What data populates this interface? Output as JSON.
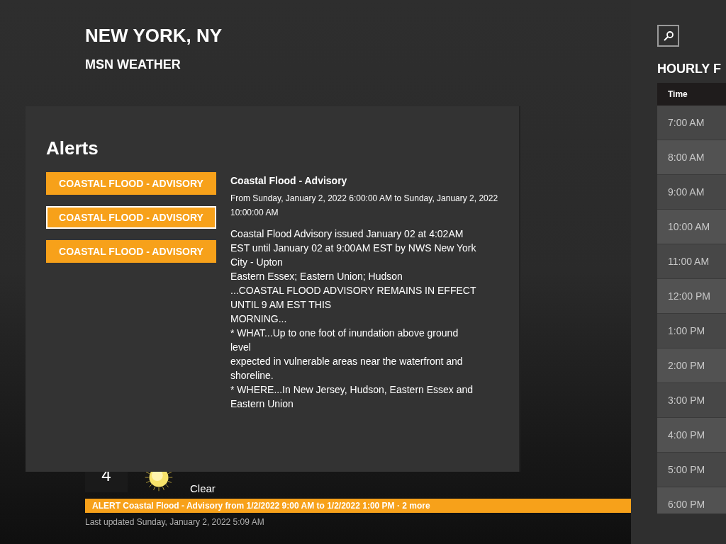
{
  "header": {
    "city": "NEW YORK, NY",
    "app": "MSN WEATHER"
  },
  "alerts_dialog": {
    "title": "Alerts",
    "items": [
      {
        "label": "COASTAL FLOOD - ADVISORY",
        "selected": false
      },
      {
        "label": "COASTAL FLOOD - ADVISORY",
        "selected": true
      },
      {
        "label": "COASTAL FLOOD - ADVISORY",
        "selected": false
      }
    ],
    "detail": {
      "title": "Coastal Flood - Advisory",
      "period": "From Sunday, January 2, 2022 6:00:00 AM to Sunday, January 2, 2022 10:00:00 AM",
      "body": "Coastal Flood Advisory issued January 02 at 4:02AM EST until January 02 at 9:00AM EST by NWS New York City - Upton\nEastern Essex; Eastern Union; Hudson\n...COASTAL FLOOD ADVISORY REMAINS IN EFFECT UNTIL 9 AM EST THIS\nMORNING...\n* WHAT...Up to one foot of inundation above ground level\nexpected in vulnerable areas near the waterfront and shoreline.\n* WHERE...In New Jersey, Hudson, Eastern Essex and Eastern Union"
    }
  },
  "forecast_day": {
    "day": "4",
    "condition": "Clear"
  },
  "alert_bar": "ALERT Coastal Flood - Advisory from 1/2/2022 9:00 AM to 1/2/2022 1:00 PM · 2 more",
  "last_updated": "Last updated Sunday, January 2, 2022 5:09 AM",
  "hourly": {
    "title": "HOURLY F",
    "column": "Time",
    "rows": [
      "7:00 AM",
      "8:00 AM",
      "9:00 AM",
      "10:00 AM",
      "11:00 AM",
      "12:00 PM",
      "1:00 PM",
      "2:00 PM",
      "3:00 PM",
      "4:00 PM",
      "5:00 PM",
      "6:00 PM"
    ]
  }
}
